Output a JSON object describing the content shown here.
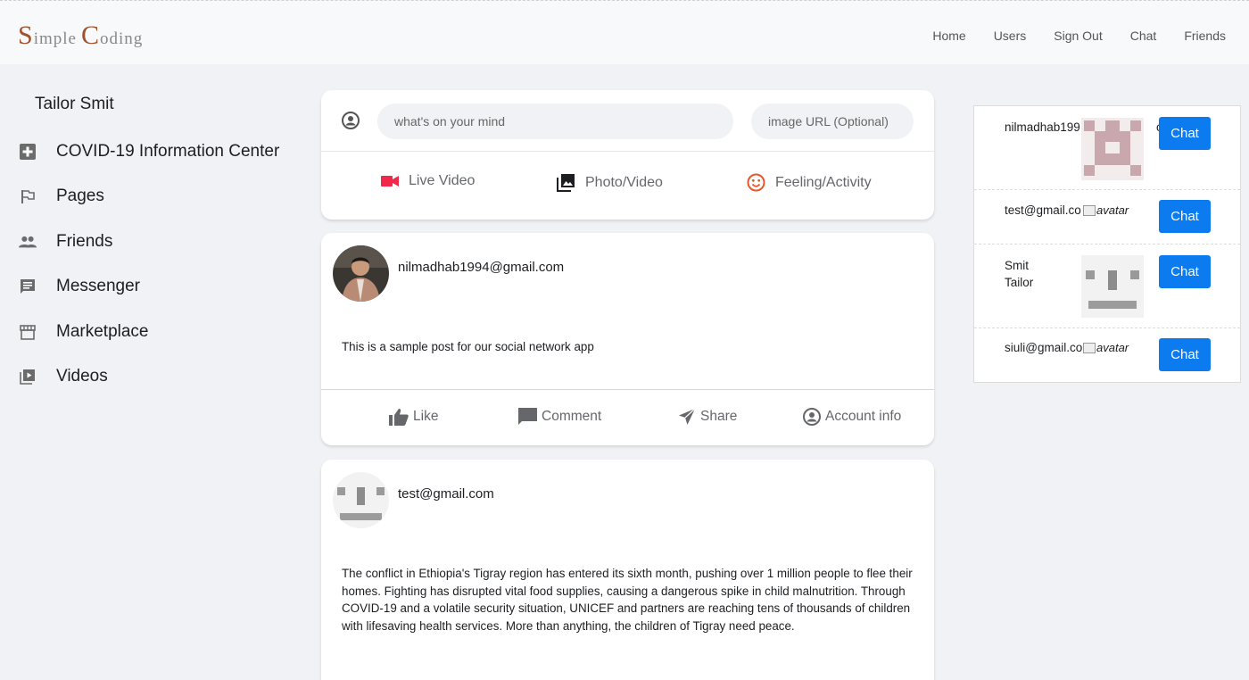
{
  "brand": {
    "first_initial": "S",
    "first_rest": "imple",
    "second_initial": "C",
    "second_rest": "oding"
  },
  "nav": {
    "items": [
      "Home",
      "Users",
      "Sign Out",
      "Chat",
      "Friends"
    ]
  },
  "sidebar": {
    "user_name": "Tailor Smit",
    "items": [
      {
        "label": "COVID-19 Information Center",
        "icon": "local-hospital-icon"
      },
      {
        "label": "Pages",
        "icon": "emoji-flags-icon"
      },
      {
        "label": "Friends",
        "icon": "people-icon"
      },
      {
        "label": "Messenger",
        "icon": "chat-icon"
      },
      {
        "label": "Marketplace",
        "icon": "storefront-icon"
      },
      {
        "label": "Videos",
        "icon": "video-library-icon"
      }
    ]
  },
  "composer": {
    "mind_placeholder": "what's on your mind",
    "url_placeholder": "image URL (Optional)",
    "options": [
      {
        "label": "Live Video",
        "icon": "videocam-icon",
        "color": "#f02849"
      },
      {
        "label": "Photo/Video",
        "icon": "photo-library-icon",
        "color": "#1c1e21"
      },
      {
        "label": "Feeling/Activity",
        "icon": "smiley-icon",
        "color": "#e4582b"
      }
    ]
  },
  "posts": [
    {
      "author": "nilmadhab1994@gmail.com",
      "text": "This is a sample post for our social network app",
      "actions": {
        "like": "Like",
        "comment": "Comment",
        "share": "Share",
        "account": "Account info"
      }
    },
    {
      "author": "test@gmail.com",
      "text": "The conflict in Ethiopia's Tigray region has entered its sixth month, pushing over 1 million people to flee their homes. Fighting has disrupted vital food supplies, causing a dangerous spike in child malnutrition. Through COVID-19 and a volatile security situation, UNICEF and partners are reaching tens of thousands of children with lifesaving health services. More than anything, the children of Tigray need peace."
    }
  ],
  "users": [
    {
      "name": "nilmadhab199",
      "name_tail": "om",
      "chat_label": "Chat"
    },
    {
      "name": "test@gmail.co",
      "broken_alt": "avatar",
      "chat_label": "Chat"
    },
    {
      "name_line1": "Smit",
      "name_line2": "Tailor",
      "chat_label": "Chat"
    },
    {
      "name": "siuli@gmail.co",
      "broken_alt": "avatar",
      "chat_label": "Chat"
    }
  ],
  "colors": {
    "accent": "#0d7bf0",
    "brand": "#a0522d",
    "background": "#f0f2f5"
  }
}
